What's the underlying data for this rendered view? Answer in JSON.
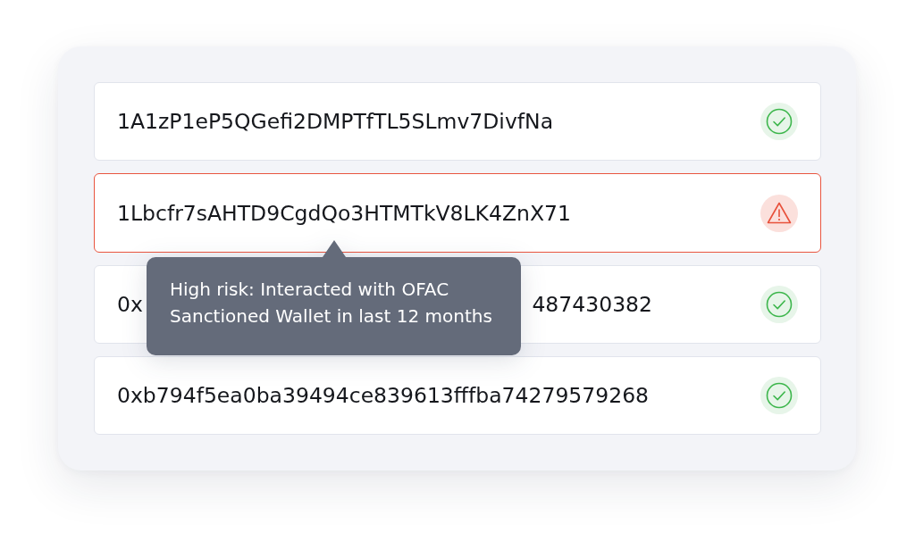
{
  "addresses": [
    {
      "address": "1A1zP1eP5QGefi2DMPTfTL5SLmv7DivfNa",
      "high_risk": false
    },
    {
      "address": "1Lbcfr7sAHTD9CgdQo3HTMTkV8LK4ZnX71",
      "high_risk": true,
      "tooltip": "High risk: Interacted with OFAC Sanctioned Wallet in last 12 months"
    },
    {
      "address_visible_parts": [
        "0x",
        "487430382"
      ],
      "high_risk": false
    },
    {
      "address": "0xb794f5ea0ba39494ce839613fffba74279579268",
      "high_risk": false
    }
  ]
}
